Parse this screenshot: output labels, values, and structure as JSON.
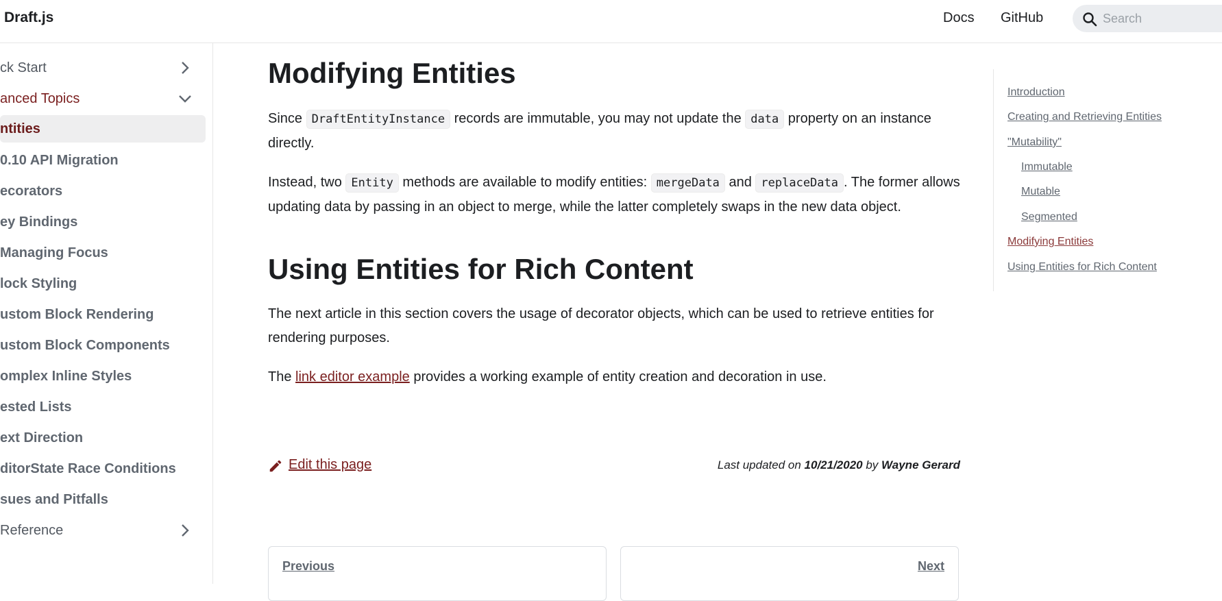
{
  "navbar": {
    "brand": "Draft.js",
    "links": [
      {
        "label": "Docs"
      },
      {
        "label": "GitHub"
      }
    ],
    "search": {
      "placeholder": "Search",
      "value": ""
    }
  },
  "sidebar": {
    "items": [
      {
        "label": "ck Start",
        "type": "category",
        "expanded": false
      },
      {
        "label": "anced Topics",
        "type": "category",
        "expanded": true
      },
      {
        "label": "ntities",
        "type": "link",
        "active": true
      },
      {
        "label": "0.10 API Migration",
        "type": "link"
      },
      {
        "label": "ecorators",
        "type": "link"
      },
      {
        "label": "ey Bindings",
        "type": "link"
      },
      {
        "label": "Managing Focus",
        "type": "link"
      },
      {
        "label": "lock Styling",
        "type": "link"
      },
      {
        "label": "ustom Block Rendering",
        "type": "link"
      },
      {
        "label": "ustom Block Components",
        "type": "link"
      },
      {
        "label": "omplex Inline Styles",
        "type": "link"
      },
      {
        "label": "ested Lists",
        "type": "link"
      },
      {
        "label": "ext Direction",
        "type": "link"
      },
      {
        "label": "ditorState Race Conditions",
        "type": "link"
      },
      {
        "label": "sues and Pitfalls",
        "type": "link"
      },
      {
        "label": "Reference",
        "type": "category",
        "expanded": false
      }
    ]
  },
  "main": {
    "heading1": "Modifying Entities",
    "p1": {
      "t1": "Since ",
      "c1": "DraftEntityInstance",
      "t2": " records are immutable, you may not update the ",
      "c2": "data",
      "t3": " property on an instance directly."
    },
    "p2": {
      "t1": "Instead, two ",
      "c1": "Entity",
      "t2": " methods are available to modify entities: ",
      "c2": "mergeData",
      "t3": " and ",
      "c3": "replaceData",
      "t4": ". The former allows updating data by passing in an object to merge, while the latter completely swaps in the new data object."
    },
    "heading2": "Using Entities for Rich Content",
    "p3": "The next article in this section covers the usage of decorator objects, which can be used to retrieve entities for rendering purposes.",
    "p4": {
      "t1": "The ",
      "link": "link editor example",
      "t2": " provides a working example of entity creation and decoration in use."
    },
    "edit_label": "Edit this page",
    "last_updated": {
      "prefix": "Last updated on ",
      "date": "10/21/2020",
      "by": " by ",
      "author": "Wayne Gerard"
    },
    "pager": {
      "prev_label": "Previous",
      "next_label": "Next"
    }
  },
  "toc": {
    "items": [
      {
        "label": "Introduction"
      },
      {
        "label": "Creating and Retrieving Entities"
      },
      {
        "label": "\"Mutability\""
      },
      {
        "label": "Immutable",
        "indent": true
      },
      {
        "label": "Mutable",
        "indent": true
      },
      {
        "label": "Segmented",
        "indent": true
      },
      {
        "label": "Modifying Entities",
        "active": true
      },
      {
        "label": "Using Entities for Rich Content"
      }
    ]
  },
  "colors": {
    "accent": "#7a1f1f",
    "active_bg": "#eeeeef",
    "code_bg": "#f2f2f4"
  },
  "icons": [
    "search-icon",
    "chevron-right-icon",
    "chevron-down-icon",
    "pencil-icon"
  ]
}
